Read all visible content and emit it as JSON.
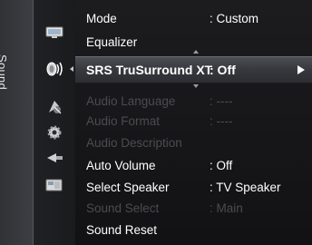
{
  "side_tab": {
    "label": "Sound"
  },
  "icons": [
    {
      "name": "picture-icon"
    },
    {
      "name": "sound-icon"
    },
    {
      "name": "channel-icon"
    },
    {
      "name": "setup-icon"
    },
    {
      "name": "input-icon"
    },
    {
      "name": "application-icon"
    }
  ],
  "menu": {
    "items": [
      {
        "label": "Mode",
        "value": ": Custom",
        "state": "enabled"
      },
      {
        "label": "Equalizer",
        "value": "",
        "state": "enabled"
      },
      {
        "label": "SRS TruSurround XT",
        "value": ": Off",
        "state": "selected"
      },
      {
        "label": "Audio Language",
        "value": ": ----",
        "state": "disabled"
      },
      {
        "label": "Audio Format",
        "value": ": ----",
        "state": "disabled"
      },
      {
        "label": "Audio Description",
        "value": "",
        "state": "disabled"
      },
      {
        "label": "Auto Volume",
        "value": ": Off",
        "state": "enabled"
      },
      {
        "label": "Select Speaker",
        "value": ": TV Speaker",
        "state": "enabled"
      },
      {
        "label": "Sound Select",
        "value": ": Main",
        "state": "disabled"
      },
      {
        "label": "Sound Reset",
        "value": "",
        "state": "enabled"
      }
    ]
  },
  "colors": {
    "highlight_text": "#ffffff",
    "enabled_text": "#ffffff",
    "disabled_text": "#4a4c50",
    "background": "#161618"
  }
}
